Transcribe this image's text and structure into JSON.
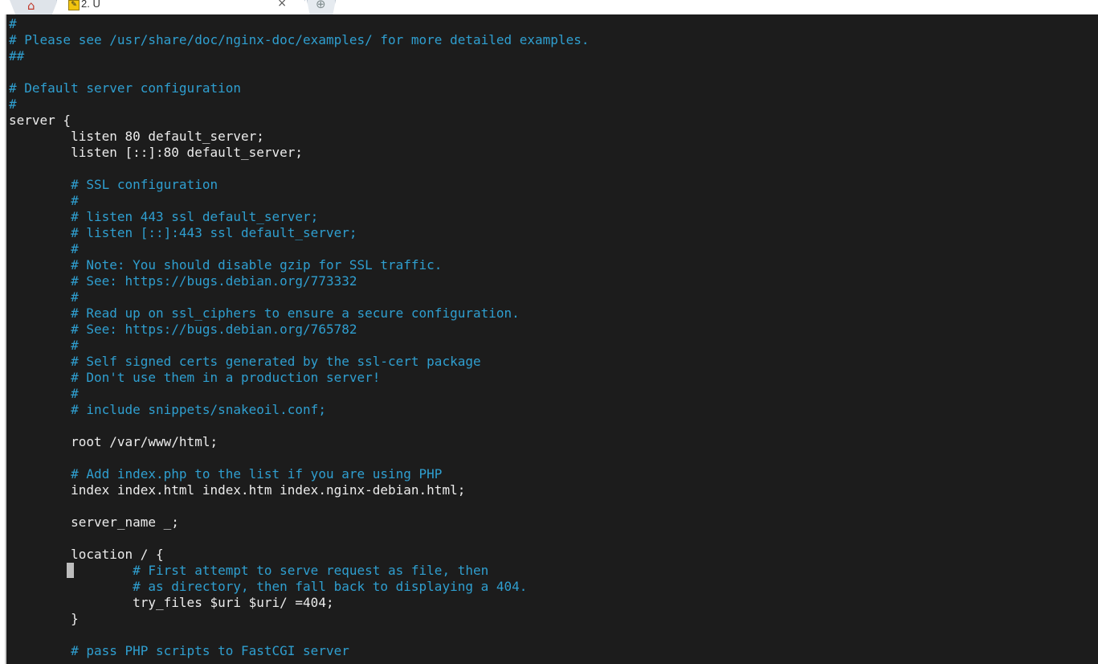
{
  "tabs": {
    "home_icon": "home-icon",
    "active_label": "2. U",
    "active_icon": "terminal-session-icon",
    "close_glyph": "×",
    "new_tab_icon": "plus-icon"
  },
  "colors": {
    "terminal_bg": "#1c1c1c",
    "text": "#ececec",
    "comment": "#2f9fd0"
  },
  "terminal": {
    "lines": [
      {
        "text": "#",
        "kind": "comment"
      },
      {
        "text": "# Please see /usr/share/doc/nginx-doc/examples/ for more detailed examples.",
        "kind": "comment"
      },
      {
        "text": "##",
        "kind": "comment"
      },
      {
        "text": "",
        "kind": "blank"
      },
      {
        "text": "# Default server configuration",
        "kind": "comment"
      },
      {
        "text": "#",
        "kind": "comment"
      },
      {
        "text": "server {",
        "kind": "code"
      },
      {
        "text": "        listen 80 default_server;",
        "kind": "code"
      },
      {
        "text": "        listen [::]:80 default_server;",
        "kind": "code"
      },
      {
        "text": "",
        "kind": "blank"
      },
      {
        "text": "        # SSL configuration",
        "kind": "comment"
      },
      {
        "text": "        #",
        "kind": "comment"
      },
      {
        "text": "        # listen 443 ssl default_server;",
        "kind": "comment"
      },
      {
        "text": "        # listen [::]:443 ssl default_server;",
        "kind": "comment"
      },
      {
        "text": "        #",
        "kind": "comment"
      },
      {
        "text": "        # Note: You should disable gzip for SSL traffic.",
        "kind": "comment"
      },
      {
        "text": "        # See: https://bugs.debian.org/773332",
        "kind": "comment"
      },
      {
        "text": "        #",
        "kind": "comment"
      },
      {
        "text": "        # Read up on ssl_ciphers to ensure a secure configuration.",
        "kind": "comment"
      },
      {
        "text": "        # See: https://bugs.debian.org/765782",
        "kind": "comment"
      },
      {
        "text": "        #",
        "kind": "comment"
      },
      {
        "text": "        # Self signed certs generated by the ssl-cert package",
        "kind": "comment"
      },
      {
        "text": "        # Don't use them in a production server!",
        "kind": "comment"
      },
      {
        "text": "        #",
        "kind": "comment"
      },
      {
        "text": "        # include snippets/snakeoil.conf;",
        "kind": "comment"
      },
      {
        "text": "",
        "kind": "blank"
      },
      {
        "text": "        root /var/www/html;",
        "kind": "code"
      },
      {
        "text": "",
        "kind": "blank"
      },
      {
        "text": "        # Add index.php to the list if you are using PHP",
        "kind": "comment"
      },
      {
        "text": "        index index.html index.htm index.nginx-debian.html;",
        "kind": "code"
      },
      {
        "text": "",
        "kind": "blank"
      },
      {
        "text": "        server_name _;",
        "kind": "code"
      },
      {
        "text": "",
        "kind": "blank"
      },
      {
        "text": "        location / {",
        "kind": "code"
      },
      {
        "text": "                # First attempt to serve request as file, then",
        "kind": "comment"
      },
      {
        "text": "                # as directory, then fall back to displaying a 404.",
        "kind": "comment"
      },
      {
        "text": "                try_files $uri $uri/ =404;",
        "kind": "code"
      },
      {
        "text": "        }",
        "kind": "code"
      },
      {
        "text": "",
        "kind": "blank"
      },
      {
        "text": "        # pass PHP scripts to FastCGI server",
        "kind": "comment"
      }
    ]
  }
}
